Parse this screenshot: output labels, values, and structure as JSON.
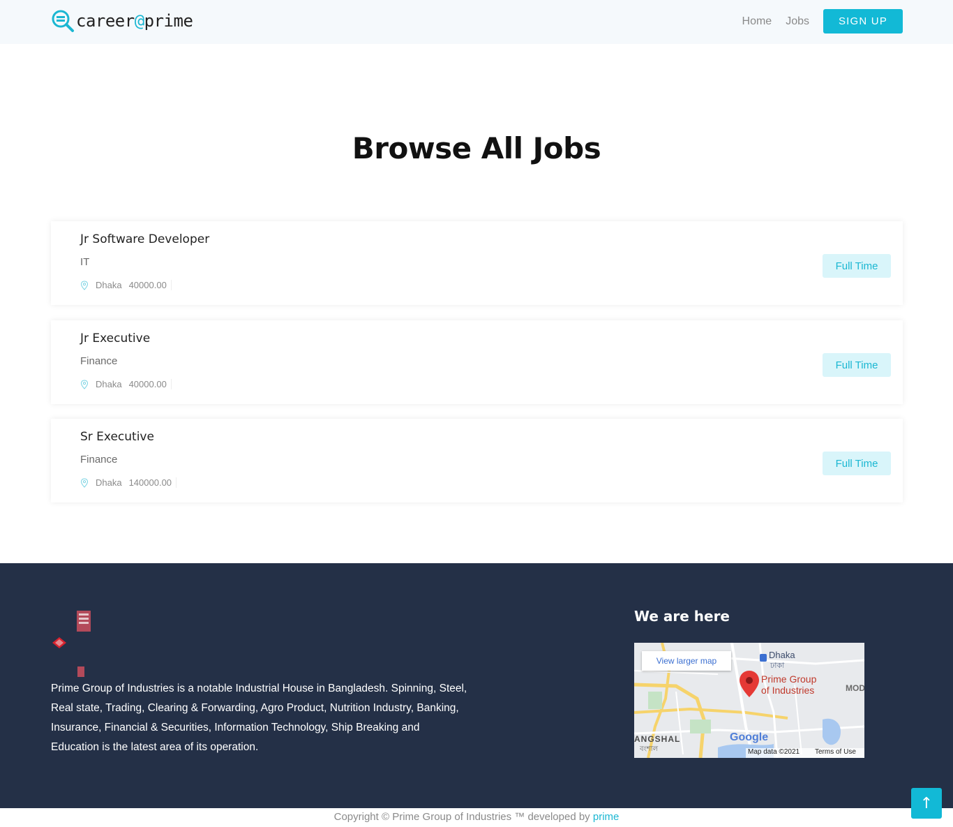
{
  "header": {
    "brand_prefix": "career",
    "brand_at": "@",
    "brand_suffix": "prime",
    "nav": {
      "home": "Home",
      "jobs": "Jobs",
      "signup": "SIGN UP"
    }
  },
  "main": {
    "title": "Browse All Jobs",
    "jobs": [
      {
        "title": "Jr Software Developer",
        "department": "IT",
        "location": "Dhaka",
        "salary": "40000.00",
        "type": "Full Time"
      },
      {
        "title": "Jr Executive",
        "department": "Finance",
        "location": "Dhaka",
        "salary": "40000.00",
        "type": "Full Time"
      },
      {
        "title": "Sr Executive",
        "department": "Finance",
        "location": "Dhaka",
        "salary": "140000.00",
        "type": "Full Time"
      }
    ]
  },
  "footer": {
    "about": "Prime Group of Industries is a notable Industrial House in Bangladesh. Spinning, Steel, Real state, Trading, Clearing & Forwarding, Agro Product, Nutrition Industry, Banking, Insurance, Financial & Securities, Information Technology, Ship Breaking and Education is the latest area of its operation.",
    "map_heading": "We are here",
    "map": {
      "view_larger": "View larger map",
      "place_name_1": "Prime Group",
      "place_name_2": "of Industries",
      "city": "Dhaka",
      "city_bn": "ঢাকা",
      "district": "ANGSHAL",
      "district_bn": "বংশাল",
      "mod": "MOD",
      "google": "Google",
      "map_data": "Map data ©2021",
      "terms": "Terms of Use"
    },
    "copyright_text": "Copyright © Prime Group of Industries ™ developed by ",
    "copyright_link": "prime",
    "scroll_top": "↑"
  },
  "colors": {
    "accent": "#12b9d6",
    "footer_bg": "#243047",
    "badge_bg": "#d9f5fa"
  }
}
